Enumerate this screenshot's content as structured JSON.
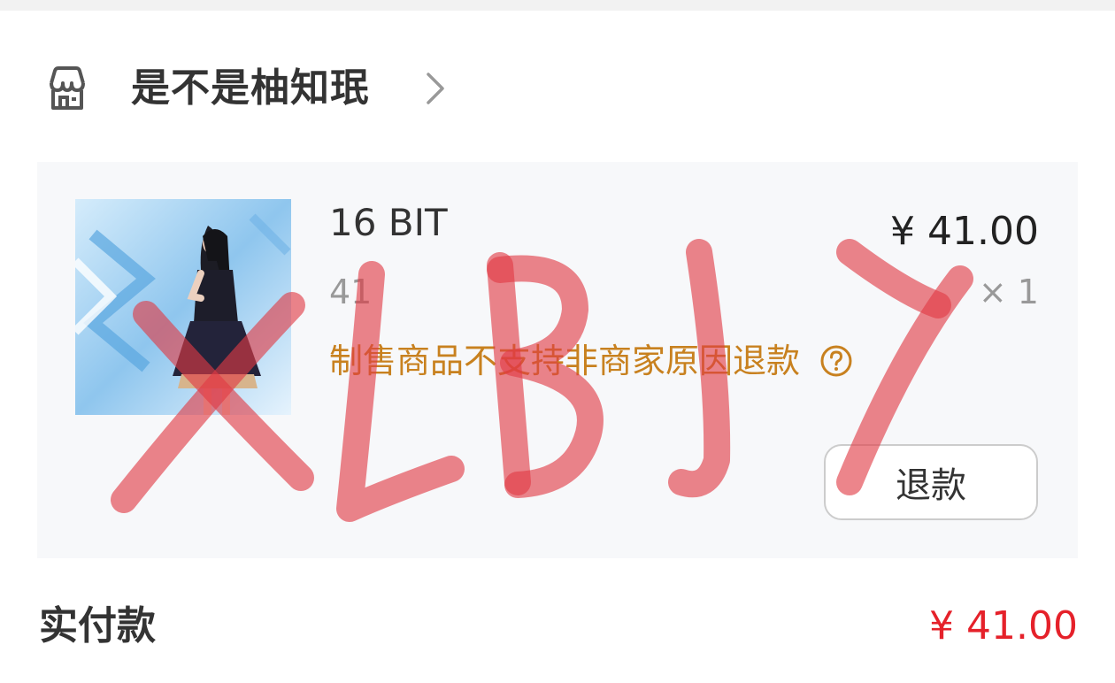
{
  "shop": {
    "icon": "store-icon",
    "name": "是不是柚知珉",
    "chevron": "chevron-right-icon"
  },
  "item": {
    "title": "16 BIT",
    "price": "¥ 41.00",
    "spec": "41",
    "quantity": "× 1",
    "notice": "制售商品不支持非商家原因退款",
    "notice_icon": "question-circle-icon",
    "refund_button": "退款"
  },
  "payment": {
    "label": "实付款",
    "value": "¥ 41.00"
  },
  "watermark": "XLBJY",
  "colors": {
    "notice": "#c8811f",
    "pay_value": "#e5212a",
    "watermark": "#e03a44"
  }
}
